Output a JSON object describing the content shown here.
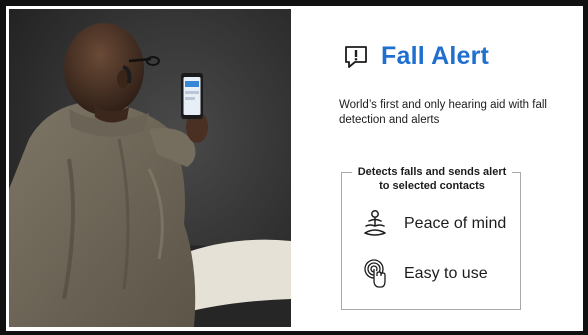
{
  "title": "Fall Alert",
  "icons": {
    "title": "exclamation-chat-icon",
    "feature_1": "meditation-icon",
    "feature_2": "touch-gesture-icon"
  },
  "subtitle": "World’s first and only hearing aid with fall detection and alerts",
  "callout": {
    "heading": "Detects falls and sends alert to selected contacts",
    "features": [
      {
        "label": "Peace of mind"
      },
      {
        "label": "Easy to use"
      }
    ]
  },
  "colors": {
    "accent": "#1f6fcf",
    "text": "#1c1c1c",
    "frame": "#111111"
  }
}
